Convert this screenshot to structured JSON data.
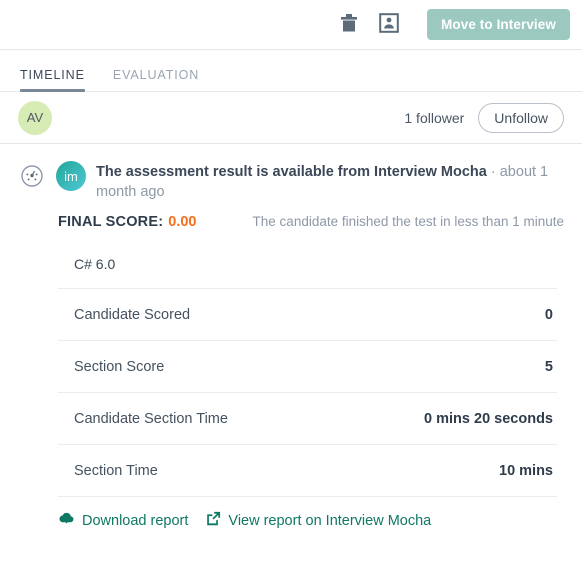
{
  "topbar": {
    "delete_icon": "trash-icon",
    "card_icon": "id-card-icon",
    "primary_button": "Move to Interview"
  },
  "tabs": [
    {
      "label": "TIMELINE",
      "active": true
    },
    {
      "label": "EVALUATION",
      "active": false
    }
  ],
  "follower_bar": {
    "avatar_initials": "AV",
    "count_text": "1 follower",
    "unfollow_label": "Unfollow"
  },
  "timeline_entry": {
    "type_icon": "assessment-gauge-icon",
    "avatar_initials": "im",
    "title": "The assessment result is available from Interview Mocha",
    "time": " · about 1 month ago",
    "score_label": "FINAL SCORE:",
    "score_value": "0.00",
    "score_note": "The candidate finished the test in less than 1 minute"
  },
  "result_table": {
    "section_title": "C# 6.0",
    "rows": [
      {
        "label": "Candidate Scored",
        "value": "0"
      },
      {
        "label": "Section Score",
        "value": "5"
      },
      {
        "label": "Candidate Section Time",
        "value": "0 mins 20 seconds"
      },
      {
        "label": "Section Time",
        "value": "10 mins"
      }
    ]
  },
  "footer_links": [
    {
      "label": "Download report",
      "icon": "cloud-download-icon"
    },
    {
      "label": "View report on Interview Mocha",
      "icon": "external-link-icon"
    }
  ],
  "colors": {
    "accent_link": "#0f7864",
    "primary_button": "#9cc9bf",
    "score_orange": "#f3701b",
    "avatar_green": "#d7ecb4",
    "tab_underline": "#7a8799"
  }
}
